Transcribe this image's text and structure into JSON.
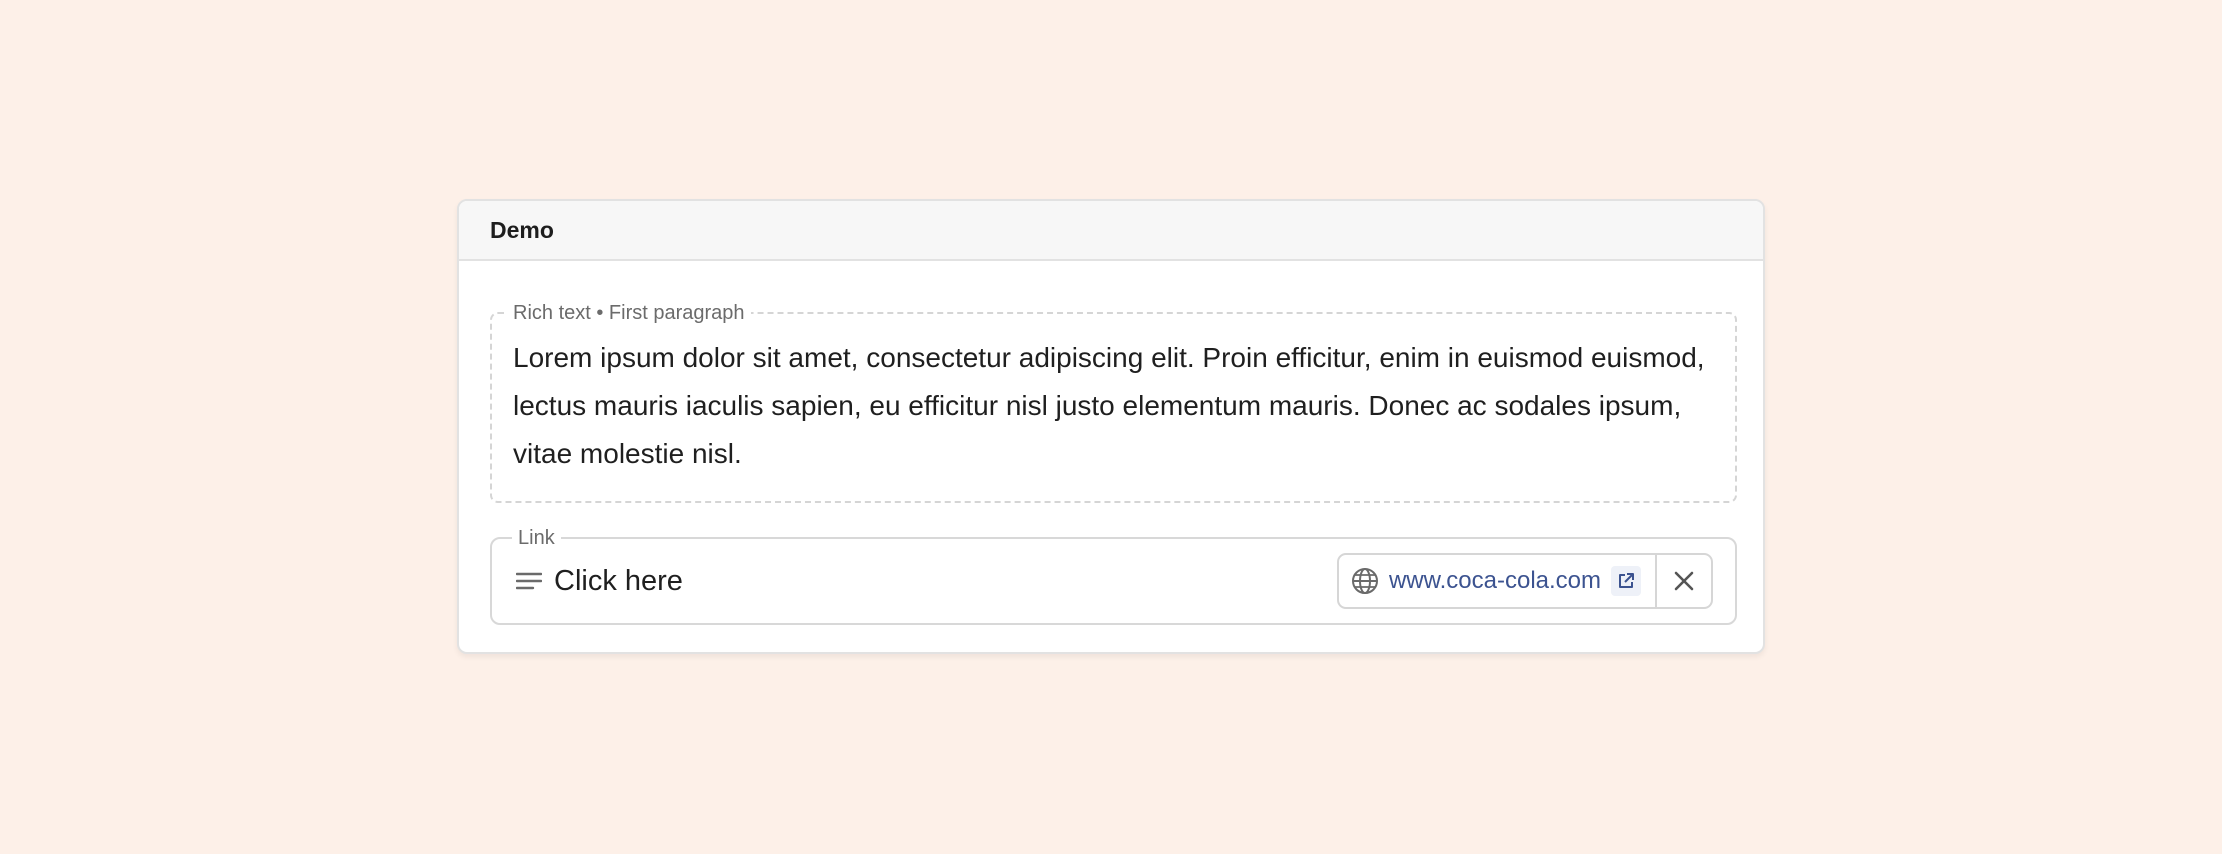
{
  "card": {
    "title": "Demo"
  },
  "rich_text": {
    "legend": "Rich text • First paragraph",
    "paragraph": "Lorem ipsum dolor sit amet, consectetur adipiscing elit. Proin efficitur, enim in euismod euismod, lectus mauris iaculis sapien, eu efficitur nisl justo elementum mauris. Donec ac sodales ipsum, vitae molestie nisl."
  },
  "link": {
    "legend": "Link",
    "text": "Click here",
    "text_icon": "lines-icon",
    "url": "www.coca-cola.com",
    "url_icon": "globe-icon",
    "open_icon": "external-link-icon",
    "clear_icon": "close-icon"
  },
  "colors": {
    "background": "#fdf0e8",
    "link": "#3c5390",
    "border": "#e2e2e2"
  }
}
